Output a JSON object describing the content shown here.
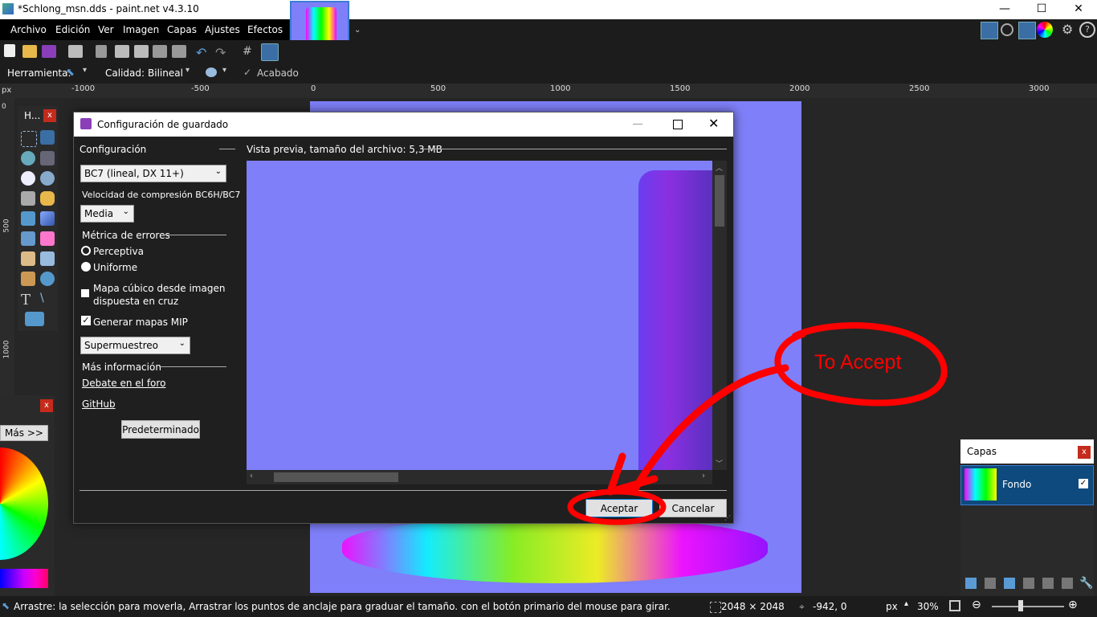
{
  "app": {
    "title": "*Schlong_msn.dds - paint.net v4.3.10"
  },
  "window_controls": {
    "minimize": "—",
    "maximize": "☐",
    "close": "✕"
  },
  "menu": [
    "Archivo",
    "Edición",
    "Ver",
    "Imagen",
    "Capas",
    "Ajustes",
    "Efectos"
  ],
  "toolbar": {
    "herramienta_label": "Herramienta:",
    "calidad_label": "Calidad:",
    "calidad_value": "Bilineal",
    "acabado_label": "Acabado"
  },
  "ruler": {
    "unit": "px",
    "top_ticks": [
      "-1000",
      "-500",
      "0",
      "500",
      "1000",
      "1500",
      "2000",
      "2500",
      "3000"
    ],
    "left_ticks": [
      "0",
      "500",
      "1000"
    ]
  },
  "tools_panel": {
    "title": "H...",
    "close": "x"
  },
  "colors_panel": {
    "more_button": "Más >>",
    "close": "x"
  },
  "layers_panel": {
    "title": "Capas",
    "close": "x",
    "layers": [
      {
        "name": "Fondo",
        "visible": true
      }
    ]
  },
  "dialog": {
    "title": "Configuración de guardado",
    "config_label": "Configuración",
    "format_value": "BC7 (lineal, DX 11+)",
    "compression_label": "Velocidad de compresión BC6H/BC7",
    "compression_value": "Media",
    "error_metric_label": "Métrica de errores",
    "radio_perceptual": "Perceptiva",
    "radio_uniform": "Uniforme",
    "cubemap_label_1": "Mapa cúbico desde imagen",
    "cubemap_label_2": "dispuesta en cruz",
    "cubemap_checked": false,
    "mipmaps_label": "Generar mapas MIP",
    "mipmaps_checked": true,
    "resample_value": "Supermuestreo",
    "more_info_label": "Más información",
    "forum_link": "Debate en el foro",
    "github_link": "GitHub",
    "default_button": "Predeterminado",
    "preview_label": "Vista previa, tamaño del archivo: 5,3 MB",
    "accept_button": "Aceptar",
    "cancel_button": "Cancelar"
  },
  "annotation": {
    "text": "To Accept",
    "color": "#ff0000"
  },
  "status": {
    "hint": "Arrastre: la selección para moverla, Arrastrar los puntos de anclaje para graduar el tamaño. con el botón primario del mouse para girar.",
    "image_size": "2048 × 2048",
    "cursor_pos": "-942, 0",
    "unit": "px",
    "zoom": "30%"
  },
  "colors": {
    "accent": "#0078d7",
    "canvas": "#7f7ff9",
    "annotation": "#ff0000"
  }
}
